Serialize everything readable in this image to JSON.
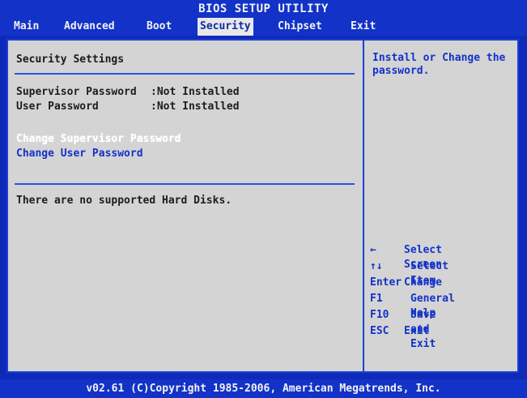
{
  "title": "BIOS SETUP UTILITY",
  "menu": [
    {
      "label": "Main",
      "active": false
    },
    {
      "label": "Advanced",
      "active": false
    },
    {
      "label": "Boot",
      "active": false
    },
    {
      "label": "Security",
      "active": true
    },
    {
      "label": "Chipset",
      "active": false
    },
    {
      "label": "Exit",
      "active": false
    }
  ],
  "main": {
    "section_title": "Security Settings",
    "supervisor_password": {
      "label": "Supervisor Password",
      "value": ":Not Installed"
    },
    "user_password": {
      "label": "User Password",
      "value": ":Not Installed"
    },
    "change_supervisor": "Change Supervisor Password",
    "change_user": "Change User Password",
    "hard_disks_note": "There are no supported Hard Disks."
  },
  "help": {
    "text": "Install or Change the\npassword."
  },
  "keys": [
    {
      "key": "←",
      "desc": "Select Screen"
    },
    {
      "key": "↑↓",
      "desc": "Select Item"
    },
    {
      "key": "Enter",
      "desc": "Change"
    },
    {
      "key": "F1",
      "desc": "General Help"
    },
    {
      "key": "F10",
      "desc": "Save and Exit"
    },
    {
      "key": "ESC",
      "desc": "Exit"
    }
  ],
  "footer": "v02.61 (C)Copyright 1985-2006, American Megatrends, Inc.",
  "colors": {
    "background": "#0f2ab8",
    "panel": "#d4d4d4",
    "accent": "#1332c8",
    "highlight": "#e8e8e8"
  }
}
